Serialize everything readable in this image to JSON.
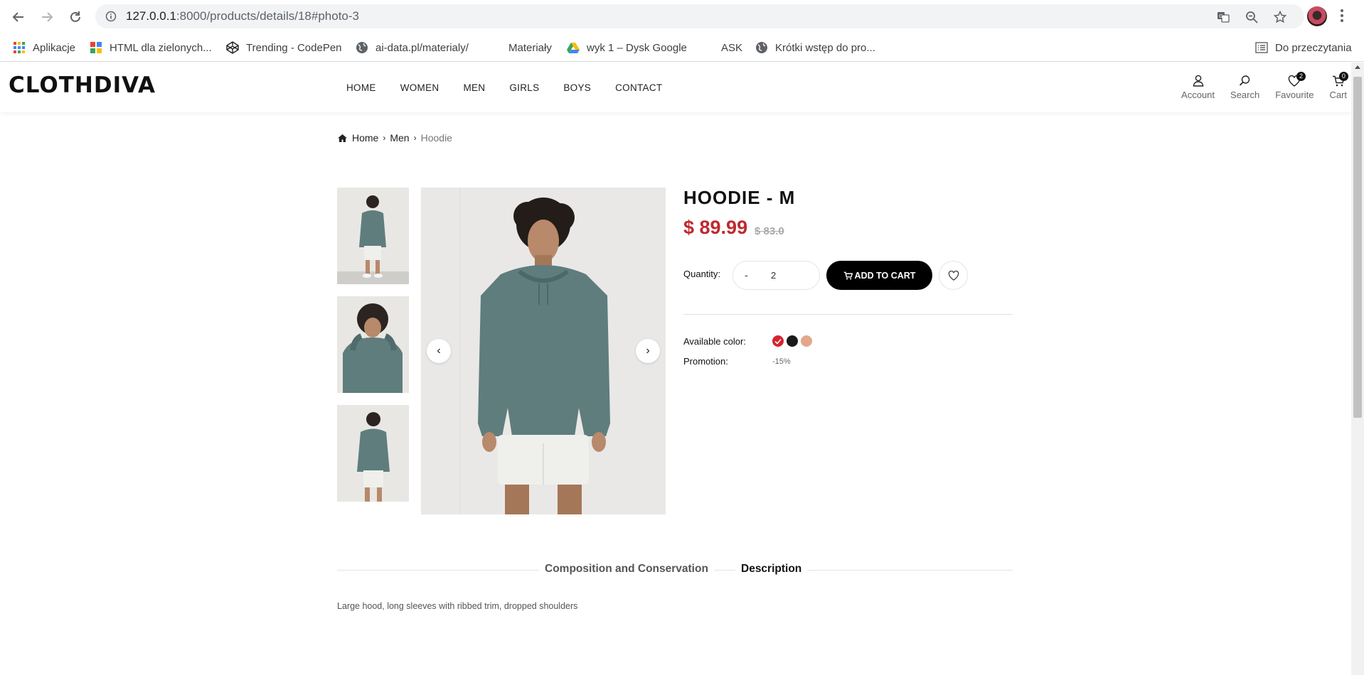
{
  "browser": {
    "url_host": "127.0.0.1",
    "url_path": ":8000/products/details/18#photo-3",
    "bookmarks": [
      {
        "label": "Aplikacje",
        "icon": "apps-grid-icon"
      },
      {
        "label": "HTML dla zielonych...",
        "icon": "html-bookmark-icon"
      },
      {
        "label": "Trending - CodePen",
        "icon": "codepen-icon"
      },
      {
        "label": "ai-data.pl/materialy/",
        "icon": "globe-icon"
      },
      {
        "label": "Materiały",
        "icon": "folder-icon"
      },
      {
        "label": "wyk 1 – Dysk Google",
        "icon": "google-drive-icon"
      },
      {
        "label": "ASK",
        "icon": "folder-icon"
      },
      {
        "label": "Krótki wstęp do pro...",
        "icon": "globe-icon"
      }
    ],
    "reading_list": "Do przeczytania"
  },
  "header": {
    "logo": "CLOTHDIVA",
    "nav": [
      "HOME",
      "WOMEN",
      "MEN",
      "GIRLS",
      "BOYS",
      "CONTACT"
    ],
    "icons": {
      "account": "Account",
      "search": "Search",
      "favourite": "Favourite",
      "favourite_count": "2",
      "cart": "Cart",
      "cart_count": "0"
    }
  },
  "breadcrumb": {
    "home": "Home",
    "category": "Men",
    "current": "Hoodie"
  },
  "product": {
    "title": "HOODIE - M",
    "price": "$ 89.99",
    "old_price": "$ 83.0",
    "quantity_label": "Quantity:",
    "quantity_minus": "-",
    "quantity": "2",
    "add_to_cart": "ADD TO CART",
    "color_label": "Available color:",
    "colors": [
      "#d4232f",
      "#1a1a1a",
      "#e3a88a"
    ],
    "promotion_label": "Promotion:",
    "promotion_value": "-15%"
  },
  "tabs": {
    "composition": "Composition and Conservation",
    "description": "Description"
  },
  "description_text": "Large hood, long sleeves with ribbed trim, dropped shoulders",
  "colors": {
    "price_red": "#c0282e",
    "hoodie": "#5f7d7d",
    "shorts": "#efefec"
  }
}
